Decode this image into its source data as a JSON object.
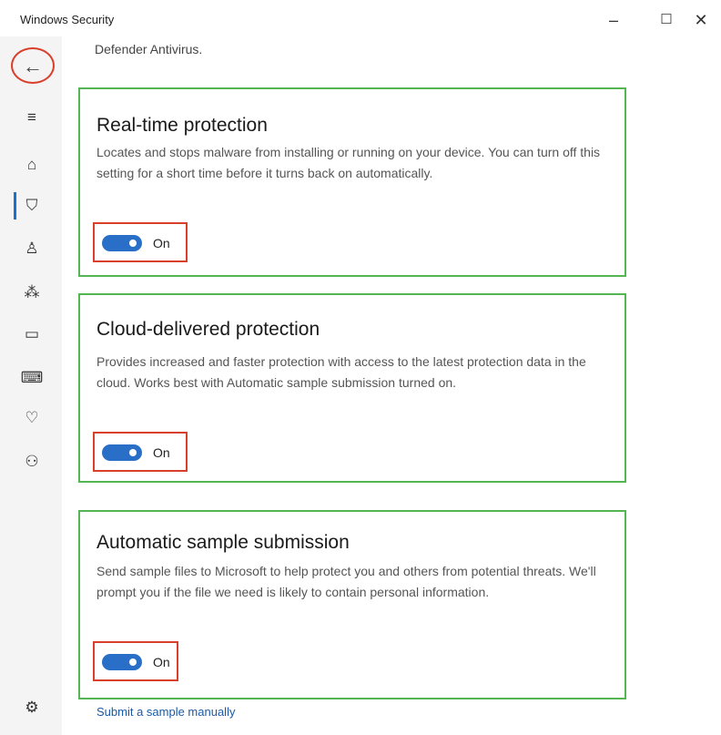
{
  "window": {
    "title": "Windows Security",
    "minimize_glyph": "–",
    "maximize_glyph": "☐",
    "close_glyph": "✕"
  },
  "sidebar": {
    "back_glyph": "←",
    "items": [
      {
        "icon": "hamburger-menu-icon",
        "glyph": "≡"
      },
      {
        "icon": "home-icon",
        "glyph": "⌂"
      },
      {
        "icon": "shield-icon",
        "glyph": "⛉"
      },
      {
        "icon": "account-icon",
        "glyph": "♙"
      },
      {
        "icon": "network-icon",
        "glyph": "⁂"
      },
      {
        "icon": "app-browser-icon",
        "glyph": "▭"
      },
      {
        "icon": "device-security-icon",
        "glyph": "⌨"
      },
      {
        "icon": "health-icon",
        "glyph": "♡"
      },
      {
        "icon": "family-icon",
        "glyph": "⚇"
      }
    ],
    "settings_glyph": "⚙"
  },
  "main": {
    "intro_text": "Defender Antivirus.",
    "cards": [
      {
        "title": "Real-time protection",
        "description": "Locates and stops malware from installing or running on your device. You can turn off this setting for a short time before it turns back on automatically.",
        "toggle_label": "On",
        "toggle_on": true
      },
      {
        "title": "Cloud-delivered protection",
        "description": "Provides increased and faster protection with access to the latest protection data in the cloud. Works best with Automatic sample submission turned on.",
        "toggle_label": "On",
        "toggle_on": true
      },
      {
        "title": "Automatic sample submission",
        "description": "Send sample files to Microsoft to help protect you and others from potential threats. We'll prompt you if the file we need is likely to contain personal information.",
        "toggle_label": "On",
        "toggle_on": true
      }
    ],
    "submit_link": "Submit a sample manually"
  },
  "colors": {
    "accent": "#2a6fc7",
    "highlight_green": "#53b653",
    "highlight_red": "#d9402b",
    "link": "#1a5aa6"
  }
}
